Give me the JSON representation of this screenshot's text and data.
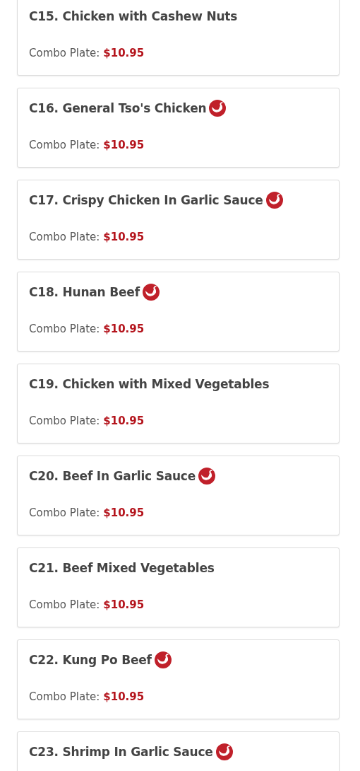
{
  "items": [
    {
      "name": "C15. Chicken with Cashew Nuts",
      "spicy": false,
      "price_label": "Combo Plate:",
      "price": "$10.95"
    },
    {
      "name": "C16. General Tso's Chicken",
      "spicy": true,
      "price_label": "Combo Plate:",
      "price": "$10.95"
    },
    {
      "name": "C17. Crispy Chicken In Garlic Sauce",
      "spicy": true,
      "price_label": "Combo Plate:",
      "price": "$10.95"
    },
    {
      "name": "C18. Hunan Beef",
      "spicy": true,
      "price_label": "Combo Plate:",
      "price": "$10.95"
    },
    {
      "name": "C19. Chicken with Mixed Vegetables",
      "spicy": false,
      "price_label": "Combo Plate:",
      "price": "$10.95"
    },
    {
      "name": "C20. Beef In Garlic Sauce",
      "spicy": true,
      "price_label": "Combo Plate:",
      "price": "$10.95"
    },
    {
      "name": "C21. Beef Mixed Vegetables",
      "spicy": false,
      "price_label": "Combo Plate:",
      "price": "$10.95"
    },
    {
      "name": "C22. Kung Po Beef",
      "spicy": true,
      "price_label": "Combo Plate:",
      "price": "$10.95"
    },
    {
      "name": "C23. Shrimp In Garlic Sauce",
      "spicy": true
    }
  ]
}
